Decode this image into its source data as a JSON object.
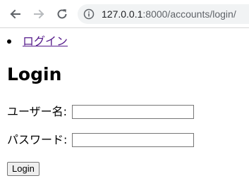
{
  "browser": {
    "back_icon": "arrow-left-icon",
    "forward_icon": "arrow-right-icon",
    "reload_icon": "reload-icon",
    "info_icon": "info-circle-icon",
    "url_host": "127.0.0.1",
    "url_rest": ":8000/accounts/login/"
  },
  "nav": {
    "items": [
      {
        "label": "ログイン"
      }
    ],
    "link_color": "#551a8b"
  },
  "page": {
    "title": "Login"
  },
  "form": {
    "username_label": "ユーザー名:",
    "username_value": "",
    "password_label": "パスワード:",
    "password_value": "",
    "submit_label": "Login"
  }
}
